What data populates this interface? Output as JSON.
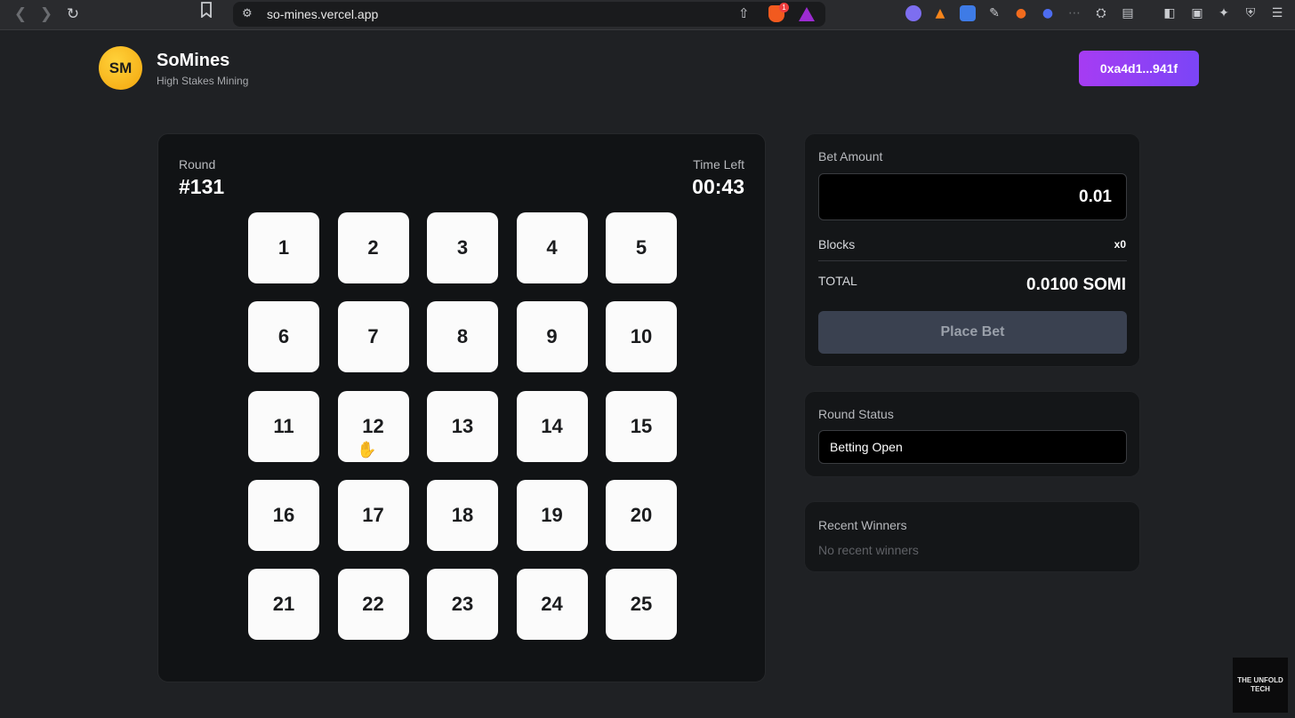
{
  "browser": {
    "url": "so-mines.vercel.app",
    "brave_badge": "1",
    "icons": {
      "back": "chevron-left-icon",
      "forward": "chevron-right-icon",
      "reload": "reload-icon",
      "bookmark": "bookmark-icon",
      "site_settings": "tune-icon",
      "share": "share-icon"
    }
  },
  "header": {
    "logo_text": "SM",
    "title": "SoMines",
    "subtitle": "High Stakes Mining",
    "wallet": "0xa4d1...941f"
  },
  "game": {
    "round_label": "Round",
    "round_value": "#131",
    "time_label": "Time Left",
    "time_value": "00:43",
    "tiles": [
      "1",
      "2",
      "3",
      "4",
      "5",
      "6",
      "7",
      "8",
      "9",
      "10",
      "11",
      "12",
      "13",
      "14",
      "15",
      "16",
      "17",
      "18",
      "19",
      "20",
      "21",
      "22",
      "23",
      "24",
      "25"
    ]
  },
  "bet": {
    "label": "Bet Amount",
    "amount": "0.01",
    "blocks_label": "Blocks",
    "blocks_value": "x0",
    "total_label": "TOTAL",
    "total_value": "0.0100 SOMI",
    "button": "Place Bet"
  },
  "status": {
    "label": "Round Status",
    "value": "Betting Open"
  },
  "winners": {
    "label": "Recent Winners",
    "empty": "No recent winners"
  },
  "watermark": {
    "line1": "THE UNFOLD",
    "line2": "TECH"
  },
  "colors": {
    "accent_purple": "#a63cf3",
    "logo_gold": "#f3a50d",
    "background": "#1f2124"
  }
}
